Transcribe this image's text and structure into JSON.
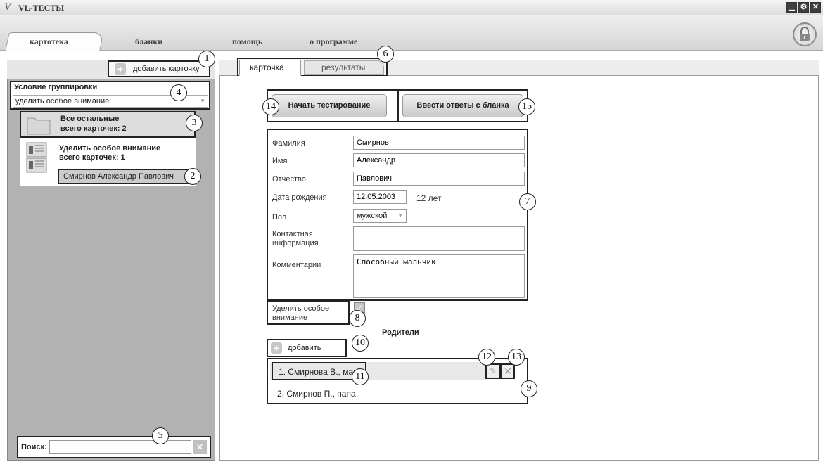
{
  "app": {
    "logo": "V",
    "title": "VL-ТЕСТЫ"
  },
  "window_controls": {
    "minimize": "▁",
    "settings": "⚙",
    "close": "✕"
  },
  "menu": {
    "items": [
      "картотека",
      "бланки",
      "помощь",
      "о программе"
    ],
    "active_index": 0
  },
  "lock_icon": "lock-icon",
  "sidebar": {
    "add_card_label": "добавить карточку",
    "group_title": "Условие группировки",
    "group_value": "уделить особое внимание",
    "folders": [
      {
        "title": "Все остальные",
        "count": "всего карточек: 2"
      },
      {
        "title": "Уделить особое внимание",
        "count": "всего карточек: 1"
      }
    ],
    "person": "Смирнов Александр Павлович",
    "search_label": "Поиск:",
    "search_value": ""
  },
  "tabs": [
    "карточка",
    "результаты"
  ],
  "buttons": {
    "start": "Начать тестирование",
    "enter": "Ввести ответы с бланка"
  },
  "form": {
    "surname_label": "Фамилия",
    "surname": "Смирнов",
    "name_label": "Имя",
    "name": "Александр",
    "patronymic_label": "Отчество",
    "patronymic": "Павлович",
    "birth_label": "Дата рождения",
    "birth": "12.05.2003",
    "age": "12 лет",
    "gender_label": "Пол",
    "gender": "мужской",
    "contact_label1": "Контактная",
    "contact_label2": "информация",
    "contact": "",
    "comments_label": "Комментарии",
    "comments": "Способный мальчик"
  },
  "attention": {
    "label1": "Уделить особое",
    "label2": "внимание",
    "checked": true
  },
  "parents": {
    "title": "Родители",
    "add_label": "добавить",
    "items": [
      "1. Смирнова В., мама",
      "2. Смирнов П., папа"
    ]
  },
  "callouts": [
    "1",
    "2",
    "3",
    "4",
    "5",
    "6",
    "7",
    "8",
    "9",
    "10",
    "11",
    "12",
    "13",
    "14",
    "15"
  ]
}
